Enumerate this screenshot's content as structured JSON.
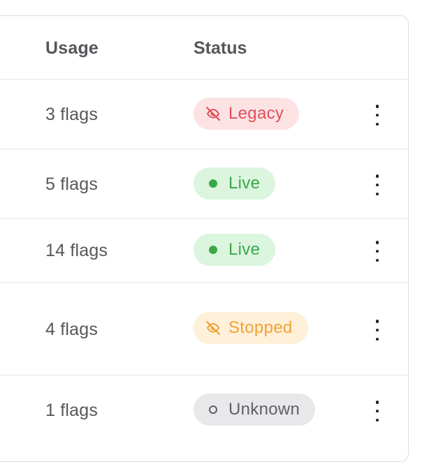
{
  "table": {
    "headers": {
      "usage": "Usage",
      "status": "Status"
    },
    "rows": [
      {
        "usage": "3 flags",
        "status": "Legacy",
        "status_icon": "eye-off-icon",
        "tone": "red"
      },
      {
        "usage": "5 flags",
        "status": "Live",
        "status_icon": "dot-filled-icon",
        "tone": "green"
      },
      {
        "usage": "14 flags",
        "status": "Live",
        "status_icon": "dot-filled-icon",
        "tone": "green"
      },
      {
        "usage": "4 flags",
        "status": "Stopped",
        "status_icon": "eye-off-icon",
        "tone": "orange"
      },
      {
        "usage": "1 flags",
        "status": "Unknown",
        "status_icon": "dot-outline-icon",
        "tone": "gray"
      }
    ]
  },
  "colors": {
    "legacy": "#e0505a",
    "live": "#3aa849",
    "stopped": "#f1a236",
    "unknown": "#606066",
    "border": "#dcdcdf"
  }
}
